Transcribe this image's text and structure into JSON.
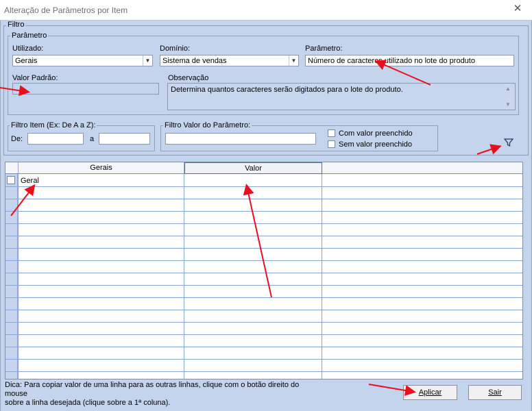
{
  "window": {
    "title": "Alteração de Parâmetros por Item",
    "close_glyph": "✕"
  },
  "filtro": {
    "legend": "Filtro",
    "parametro_group": {
      "legend": "Parâmetro",
      "utilizado": {
        "label": "Utilizado:",
        "value": "Gerais"
      },
      "dominio": {
        "label": "Domínio:",
        "value": "Sistema de vendas"
      },
      "parametro": {
        "label": "Parâmetro:",
        "value": "Número de caracteres utilizado no lote do produto"
      },
      "valor_padrao": {
        "label": "Valor Padrão:",
        "value": ""
      },
      "observacao": {
        "label": "Observação",
        "value": "Determina quantos caracteres serão digitados para o lote do produto."
      }
    },
    "filtro_item": {
      "legend": "Filtro Item (Ex: De A a Z):",
      "de_label": "De:",
      "de_value": "",
      "a_label": "a",
      "a_value": ""
    },
    "filtro_valor": {
      "legend": "Filtro Valor do Parâmetro:",
      "value": "",
      "com_valor": "Com valor preenchido",
      "sem_valor": "Sem valor preenchido"
    }
  },
  "grid": {
    "columns": [
      "Gerais",
      "Valor",
      ""
    ],
    "rows": [
      {
        "item": "Geral",
        "valor": ""
      }
    ]
  },
  "hint": {
    "line1": "Dica: Para copiar valor de uma linha para as outras linhas, clique com o botão direito do mouse",
    "line2": "sobre a linha desejada (clique sobre a 1ª coluna)."
  },
  "buttons": {
    "aplicar": "Aplicar",
    "sair": "Sair"
  },
  "icons": {
    "filter": "filter-icon",
    "arrow_color": "#e8101c"
  }
}
